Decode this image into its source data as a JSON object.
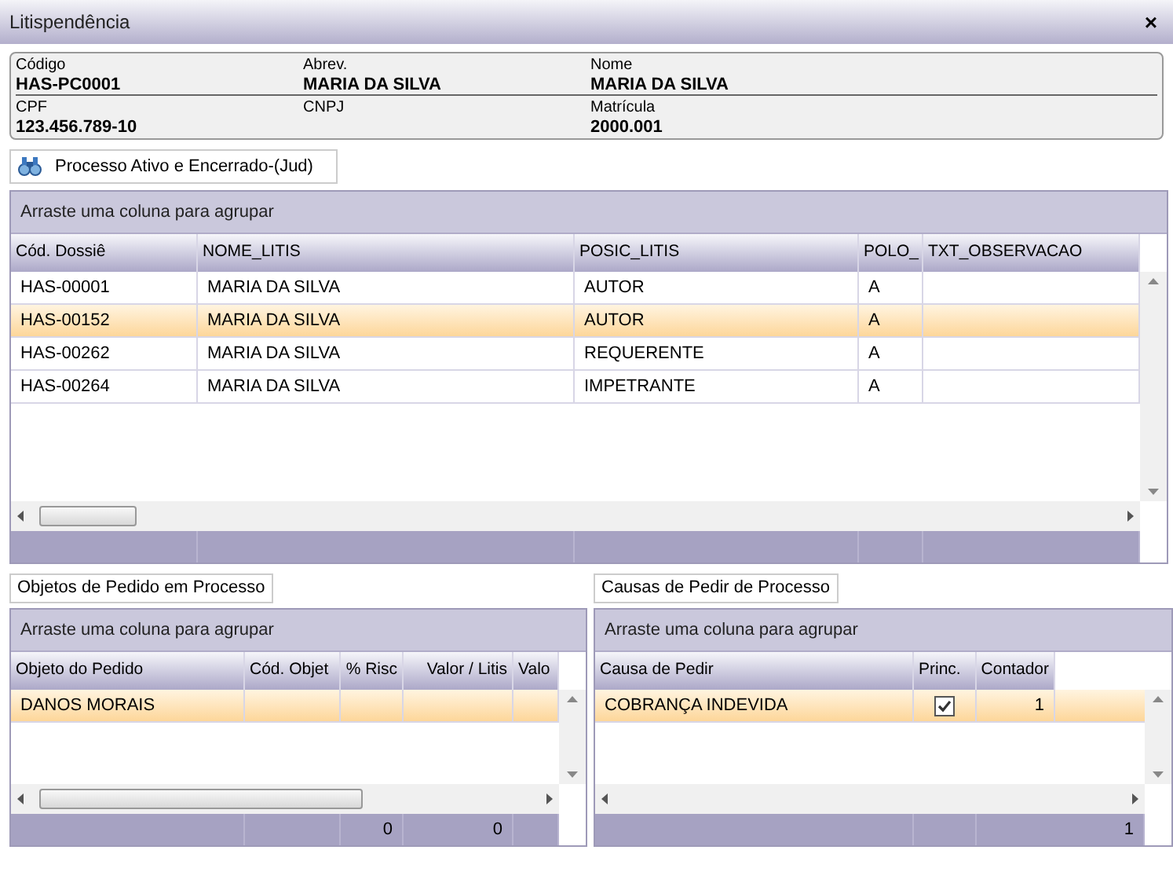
{
  "window": {
    "title": "Litispendência",
    "close": "×"
  },
  "info": [
    {
      "label": "Código",
      "value": "HAS-PC0001"
    },
    {
      "label": "Abrev.",
      "value": "MARIA DA SILVA"
    },
    {
      "label": "Nome",
      "value": "MARIA DA SILVA"
    },
    {
      "label": "CPF",
      "value": "123.456.789-10"
    },
    {
      "label": "CNPJ"
    },
    {
      "label": "Matrícula",
      "value": "2000.001"
    }
  ],
  "process_button": {
    "label": "Processo Ativo e Encerrado-(Jud)"
  },
  "grids": [
    {
      "group_hint": "Arraste uma coluna para agrupar",
      "columns": [
        {
          "label": "Cód. Dossiê"
        },
        {
          "label": "NOME_LITIS"
        },
        {
          "label": "POSIC_LITIS"
        },
        {
          "label": "POLO_"
        },
        {
          "label": "TXT_OBSERVACAO"
        }
      ],
      "rows": [
        {
          "selected": false,
          "cells": [
            {
              "kind": "text",
              "text": "HAS-00001"
            },
            {
              "kind": "text",
              "text": "MARIA DA SILVA"
            },
            {
              "kind": "text",
              "text": "AUTOR"
            },
            {
              "kind": "text",
              "text": "A"
            },
            {
              "kind": "empty"
            }
          ]
        },
        {
          "selected": true,
          "cells": [
            {
              "kind": "text",
              "text": "HAS-00152"
            },
            {
              "kind": "text",
              "text": "MARIA DA SILVA"
            },
            {
              "kind": "text",
              "text": "AUTOR"
            },
            {
              "kind": "text",
              "text": "A"
            },
            {
              "kind": "empty"
            }
          ]
        },
        {
          "selected": false,
          "cells": [
            {
              "kind": "text",
              "text": "HAS-00262"
            },
            {
              "kind": "text",
              "text": "MARIA DA SILVA"
            },
            {
              "kind": "text",
              "text": "REQUERENTE"
            },
            {
              "kind": "text",
              "text": "A"
            },
            {
              "kind": "empty"
            }
          ]
        },
        {
          "selected": false,
          "cells": [
            {
              "kind": "text",
              "text": "HAS-00264"
            },
            {
              "kind": "text",
              "text": "MARIA DA SILVA"
            },
            {
              "kind": "text",
              "text": "IMPETRANTE"
            },
            {
              "kind": "text",
              "text": "A"
            },
            {
              "kind": "empty"
            }
          ]
        }
      ]
    },
    {
      "title": "Objetos de Pedido em Processo",
      "group_hint": "Arraste uma coluna para agrupar",
      "columns": [
        {
          "label": "Objeto do Pedido"
        },
        {
          "label": "Cód. Objet"
        },
        {
          "label": "% Risc",
          "total": "0"
        },
        {
          "label": "Valor / Litis",
          "total": "0"
        },
        {
          "label": "Valo"
        }
      ],
      "rows": [
        {
          "selected": true,
          "cells": [
            {
              "kind": "text",
              "text": "DANOS MORAIS"
            },
            {
              "kind": "empty"
            },
            {
              "kind": "empty"
            },
            {
              "kind": "empty"
            },
            {
              "kind": "empty"
            }
          ]
        }
      ]
    },
    {
      "title": "Causas de Pedir de Processo",
      "group_hint": "Arraste uma coluna para agrupar",
      "columns": [
        {
          "label": "Causa de Pedir"
        },
        {
          "label": "Princ."
        },
        {
          "label": "Contador",
          "total": "1"
        }
      ],
      "rows": [
        {
          "selected": true,
          "cells": [
            {
              "kind": "text",
              "text": "COBRANÇA INDEVIDA"
            },
            {
              "kind": "checkbox",
              "checked": true
            },
            {
              "kind": "text",
              "text": "1"
            }
          ]
        }
      ]
    }
  ]
}
